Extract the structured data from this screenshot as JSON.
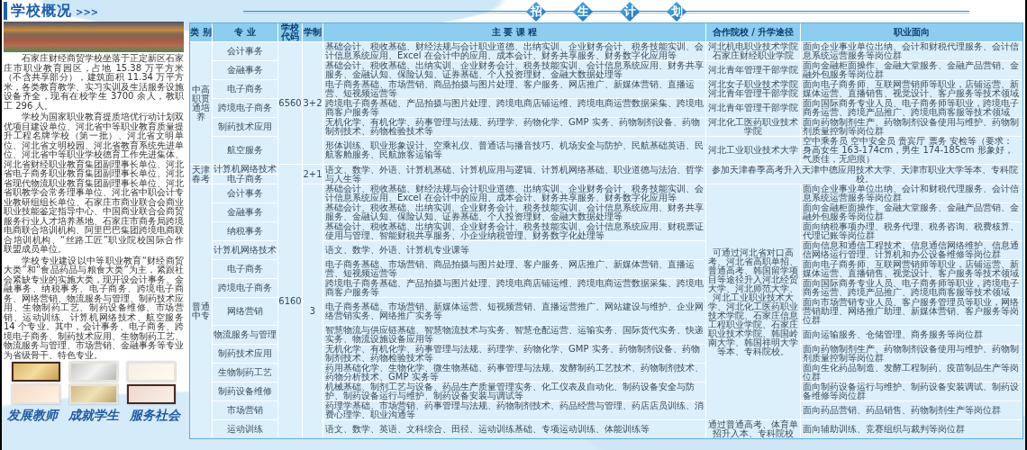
{
  "overview": {
    "title": "学校概况",
    "title_marks": ">>>",
    "paragraphs": [
      "石家庄财经商贸学校坐落于正定新区石家庄市职业教育园区，占地 15.38 万平方米（不含共享部分），建筑面积 11.34 万平方米，各类教育教学、实习实训及生活服务设施设备齐全，现有在校学生 3700 余人，教职工 296 人。",
      "学校为国家职业教育提质培优行动计划双优项目建设单位、河北省中等职业教育质量提升工程名牌学校（第一批）、河北省文明单位、河北省文明校园、河北省教育系统先进单位、河北省中等职业学校德育工作先进集体、河北省财经职业教育集团副理事长单位、河北省电子商务职业教育集团副理事长单位、河北省现代物流职业教育集团副理事长单位、河北省职教学会常务理事单位、河北省中职会计专业教研组组长单位、石家庄市商业联合会商业职业技能鉴定指导中心、中国商业联合会商贸服务行业人才培养基地、石家庄市商务局跨境电商联合培训机构、阿里巴巴集团跨境电商联合培训机构、“丝路工匠”职业院校国际合作联盟成员单位。",
      "学校专业建设以中等职业教育“财经商贸大类”和“食品药品与粮食大类”为主，紧跟社会紧缺专业的实施大类，现开设会计事务、金融事务、纳税事务、电子商务、跨境电子商务、网络营销、物流服务与管理、制药技术应用、生物制药工艺、制药设备维修、市场营销、运动训练、计算机网络技术、航空服务 14 个专业。其中，会计事务、电子商务、跨境电子商务、制药技术应用、生物制药工艺、物流服务与管理、市场营销、金融事务等专业为省级骨干、特色专业。"
    ],
    "slogan": [
      "发展教师",
      "成就学生",
      "服务社会"
    ]
  },
  "plan": {
    "title_characters": [
      "招",
      "生",
      "计",
      "划"
    ],
    "columns": [
      "类 别",
      "专 业",
      "学校代码",
      "学制",
      "主 要 课 程",
      "合作院校 / 升学途径",
      "职业面向"
    ],
    "code_groups": [
      {
        "code": "6560",
        "sections": [
          {
            "category": "中高职贯通培养",
            "duration": "3+2",
            "rows": [
              {
                "majors": [
                  "会计事务"
                ],
                "courses": "基础会计、税收基础、财经法规与会计职业道德、出纳实训、企业财务会计、税务技能实训、会计信息系统应用、Excel 在会计中的应用、成本会计、财务共享服务、财务数字化应用等",
                "partner": [
                  "河北机电职业技术学院",
                  "石家庄财经职业学院"
                ],
                "career": "面向企业事业单位出纳、会计和财税代理服务、会计信息系统运营服务等岗位群"
              },
              {
                "majors": [
                  "金融事务"
                ],
                "courses": "基础会计、税收基础、出纳实训、企业财务会计、税务技能实训、会计信息系统应用、财务共享服务、金融认知、保险认知、证券基础、个人投资理财、金融大数据处理等",
                "partner": "河北青年管理干部学院",
                "career": "面向金融柜面操作、金融大堂服务、金融产品营销、金融外包服务等岗位群"
              },
              {
                "majors": [
                  "电子商务"
                ],
                "courses": "电子商务基础、市场营销、商品拍摄与图片处理、客户服务、网店推广、新媒体营销、直播运营、短视频运营等",
                "partner": [
                  "河北女子职业技术学院",
                  "河北青年管理干部学院"
                ],
                "career": "面向电子商务师、互联网营销师等职业，店铺运营、新媒体运营、直播销售、视觉设计、客户服务等技术领域"
              },
              {
                "majors": [
                  "跨境电子商务"
                ],
                "courses": "跨境电子商务基础、产品拍摄与图片处理、跨境电商店铺运维、跨境电商运营数据采集、跨境电商客户服务等",
                "partner": "河北青年管理干部学院",
                "career": "面向国际商务专业人员、电子商务师等职业，跨境电子商务运营、跨境产品推广、跨境电商客服等技术领域"
              },
              {
                "majors": [
                  "制药技术应用"
                ],
                "courses": "无机化学、有机化学、药事管理与法规、药理学、药物化学、GMP 实务、药物制剂设备、药物制剂技术、药物检验技术等",
                "partner": "河北化工医药职业技术学院",
                "career": "面向药物制剂生产、药物制剂设备使用与维护、药物制剂质量控制等岗位群"
              },
              {
                "majors": [
                  "航空服务"
                ],
                "courses": "形体训练、职业形象设计、空乘礼仪、普通话与播音技巧、机场安全与防护、民航基础英语、民航客舱服务、民航旅客运输等",
                "partner": "河北工业职业技术大学",
                "career": "空中乘务员 空中安全员 贵宾厅 票务 安检等（要求：身高女生 163-174cm，男生 174-185cm 形象好，气质佳，无疤痕）"
              }
            ]
          }
        ]
      },
      {
        "code": "6160",
        "sections": [
          {
            "category": "天津春考",
            "duration": "2+1",
            "rows": [
              {
                "majors": [
                  "计算机网络技术",
                  "电子商务"
                ],
                "courses": "语文、数学、外语、计算机基础、计算机应用与逻辑、计算机网络基础、职业道德与法治、哲学与人生等",
                "pathway": "参加天津春季高考升入天津中德应用技术大学、天津市职业大学等本、专科院校。"
              }
            ]
          },
          {
            "category": "普通中专",
            "duration": "3",
            "shared_partner": "可通过河北省对口高考、河北省高职单招、普通高考、韩国留学项目等途径升入河北经贸大学、河北师范大学、河北工业职业技术大学、河北化工医药职业技术学院、石家庄信息工程职业学院、石家庄职业技术学院、韩国岭南大学、韩国祥明大学等本、专科院校。",
            "rows": [
              {
                "majors": [
                  "会计事务"
                ],
                "courses": "基础会计、税收基础、财经法规与会计职业道德、出纳实训、企业财务会计、税务技能实训、会计信息系统应用、Excel 在会计中的应用、成本会计、财务共享服务、财务数字化应用等",
                "career": "面向企业事业单位出纳、会计和财税代理服务、会计信息系统运营服务等岗位群"
              },
              {
                "majors": [
                  "金融事务"
                ],
                "courses": "基础会计、税收基础、出纳实训、企业财务会计、税务技能实训、会计信息系统应用、财务共享服务、金融认知、保险认知、证券基础、个人投资理财、金融大数据处理等",
                "career": "面向金融柜面操作、金融大堂服务、金融产品营销、金融外包服务等岗位群"
              },
              {
                "majors": [
                  "纳税事务"
                ],
                "courses": "基础会计、税收基础、出纳实训、企业财务会计、税务技能实训、会计信息系统应用、财税票证使用与管理、智能财税共享服务、小企业纳税管理、财务数字化处理等",
                "career": "面向纳税事项办理、税务代理、税务咨询、税费核算、代理记账等岗位群"
              },
              {
                "majors": [
                  "计算机网络技术"
                ],
                "courses": "语文、数学、外语、计算机专业课等",
                "career": "面向信息和通信工程技术、信息通信网络维护、信息通信网络运行管理、计算机和办公设备维修等岗位群"
              },
              {
                "majors": [
                  "电子商务"
                ],
                "courses": "电子商务基础、市场营销、商品拍摄与图片处理、客户服务、网店推广、新媒体营销、直播运营、短视频运营等",
                "career": "面向电子商务师、互联网营销师等职业，店铺运营、新媒体运营、直播销售、视觉设计、客户服务等技术领域"
              },
              {
                "majors": [
                  "跨境电子商务"
                ],
                "courses": "跨境电子商务基础、产品拍摄与图片处理、跨境电商店铺运维、跨境电商运营数据采集、跨境电商客户服务等",
                "career": "面向国际商务专业人员、电子商务师等职业，跨境电子商务运营、跨境产品推广、跨境电商客服等技术领域"
              },
              {
                "majors": [
                  "网络营销"
                ],
                "courses": "电子商务基础、市场营销、新媒体运营、短视频营销、直播运营推广、网站建设与维护、企业网络营销实务、网络推广实务等",
                "career": "面向市场营销专业人员、客户服务管理员等职业，网络营销助理、网络推广助理、新媒体营销、客户服务等岗位群"
              },
              {
                "majors": [
                  "物流服务与管理"
                ],
                "courses": "智慧物流与供应链基础、智慧物流技术与实务、智慧仓配运营、运输实务、国际货代实务、快递实务、物流设施设备应用等",
                "career": "面向运输服务、仓储管理、商务服务等岗位群"
              },
              {
                "majors": [
                  "制药技术应用"
                ],
                "courses": "无机化学、有机化学、药事管理与法规、药理学、药物化学、GMP 实务、药物制剂设备、药物制剂技术、药物检验技术等",
                "career": "面向药物制剂生产、药物制剂设备使用与维护、药物制剂质量控制等岗位群"
              },
              {
                "majors": [
                  "生物制药工艺"
                ],
                "courses": "药用基础化学、生物化学、微生物基础、药事管理与法规、发酵制药工艺技术、药物制剂技术、药物分析技术、GMP 实务等",
                "career": "面向生化药品制造、发酵工程制药、疫苗制品生产等岗位群"
              },
              {
                "majors": [
                  "制药设备维修"
                ],
                "courses": "机械基础、制剂工艺与设备、药品生产质量管理实务、化工仪表及自动化、制药设备安全与防护、制药设备运行与维护、制药设备安装与调试等",
                "career": "面向制药设备运行与维护、制药设备安装调试、制药设备维修等岗位群"
              },
              {
                "majors": [
                  "市场营销"
                ],
                "courses": "药理学基础、市场营销、药事管理与法规、药物制剂技术、药品经营与管理、药店店员训练、消费心理学、职业沟通等",
                "career": "面向药品营销、药品销售、药物制剂生产等岗位群"
              },
              {
                "majors": [
                  "运动训练"
                ],
                "courses": "语文、数学、英语、文科综合、田径、运动训练基础、专项运动训练、体能训练等",
                "partner": "通过普通高考、体育单招升入本、专科院校",
                "career": "面向辅助训练、竞赛组织与裁判等岗位群"
              }
            ]
          }
        ]
      }
    ]
  }
}
